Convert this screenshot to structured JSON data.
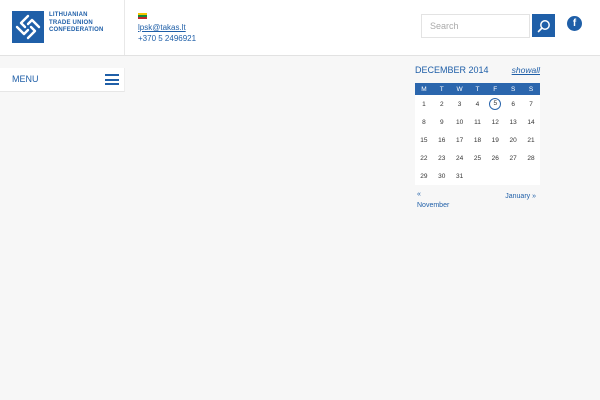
{
  "header": {
    "logo_lines": [
      "LITHUANIAN",
      "TRADE UNION",
      "CONFEDERATION"
    ],
    "email": "lpsk@takas.lt",
    "phone": "+370 5 2496921",
    "flag_colors": [
      "#f5c400",
      "#128a3b",
      "#c0272d"
    ],
    "search_placeholder": "Search",
    "fb_label": "f"
  },
  "menu": {
    "label": "MENU"
  },
  "calendar": {
    "month_label": "DECEMBER 2014",
    "showall_label": "showall",
    "weekdays": [
      "M",
      "T",
      "W",
      "T",
      "F",
      "S",
      "S"
    ],
    "weeks": [
      [
        "1",
        "2",
        "3",
        "4",
        "5",
        "6",
        "7"
      ],
      [
        "8",
        "9",
        "10",
        "11",
        "12",
        "13",
        "14"
      ],
      [
        "15",
        "16",
        "17",
        "18",
        "19",
        "20",
        "21"
      ],
      [
        "22",
        "23",
        "24",
        "25",
        "26",
        "27",
        "28"
      ],
      [
        "29",
        "30",
        "31",
        "",
        "",
        "",
        ""
      ]
    ],
    "today": "5",
    "prev_arrow": "«",
    "prev_label": "November",
    "next_label": "January »"
  },
  "colors": {
    "brand": "#1f5fa8",
    "header_row": "#2b66ad",
    "page_bg": "#f7f7f7"
  }
}
